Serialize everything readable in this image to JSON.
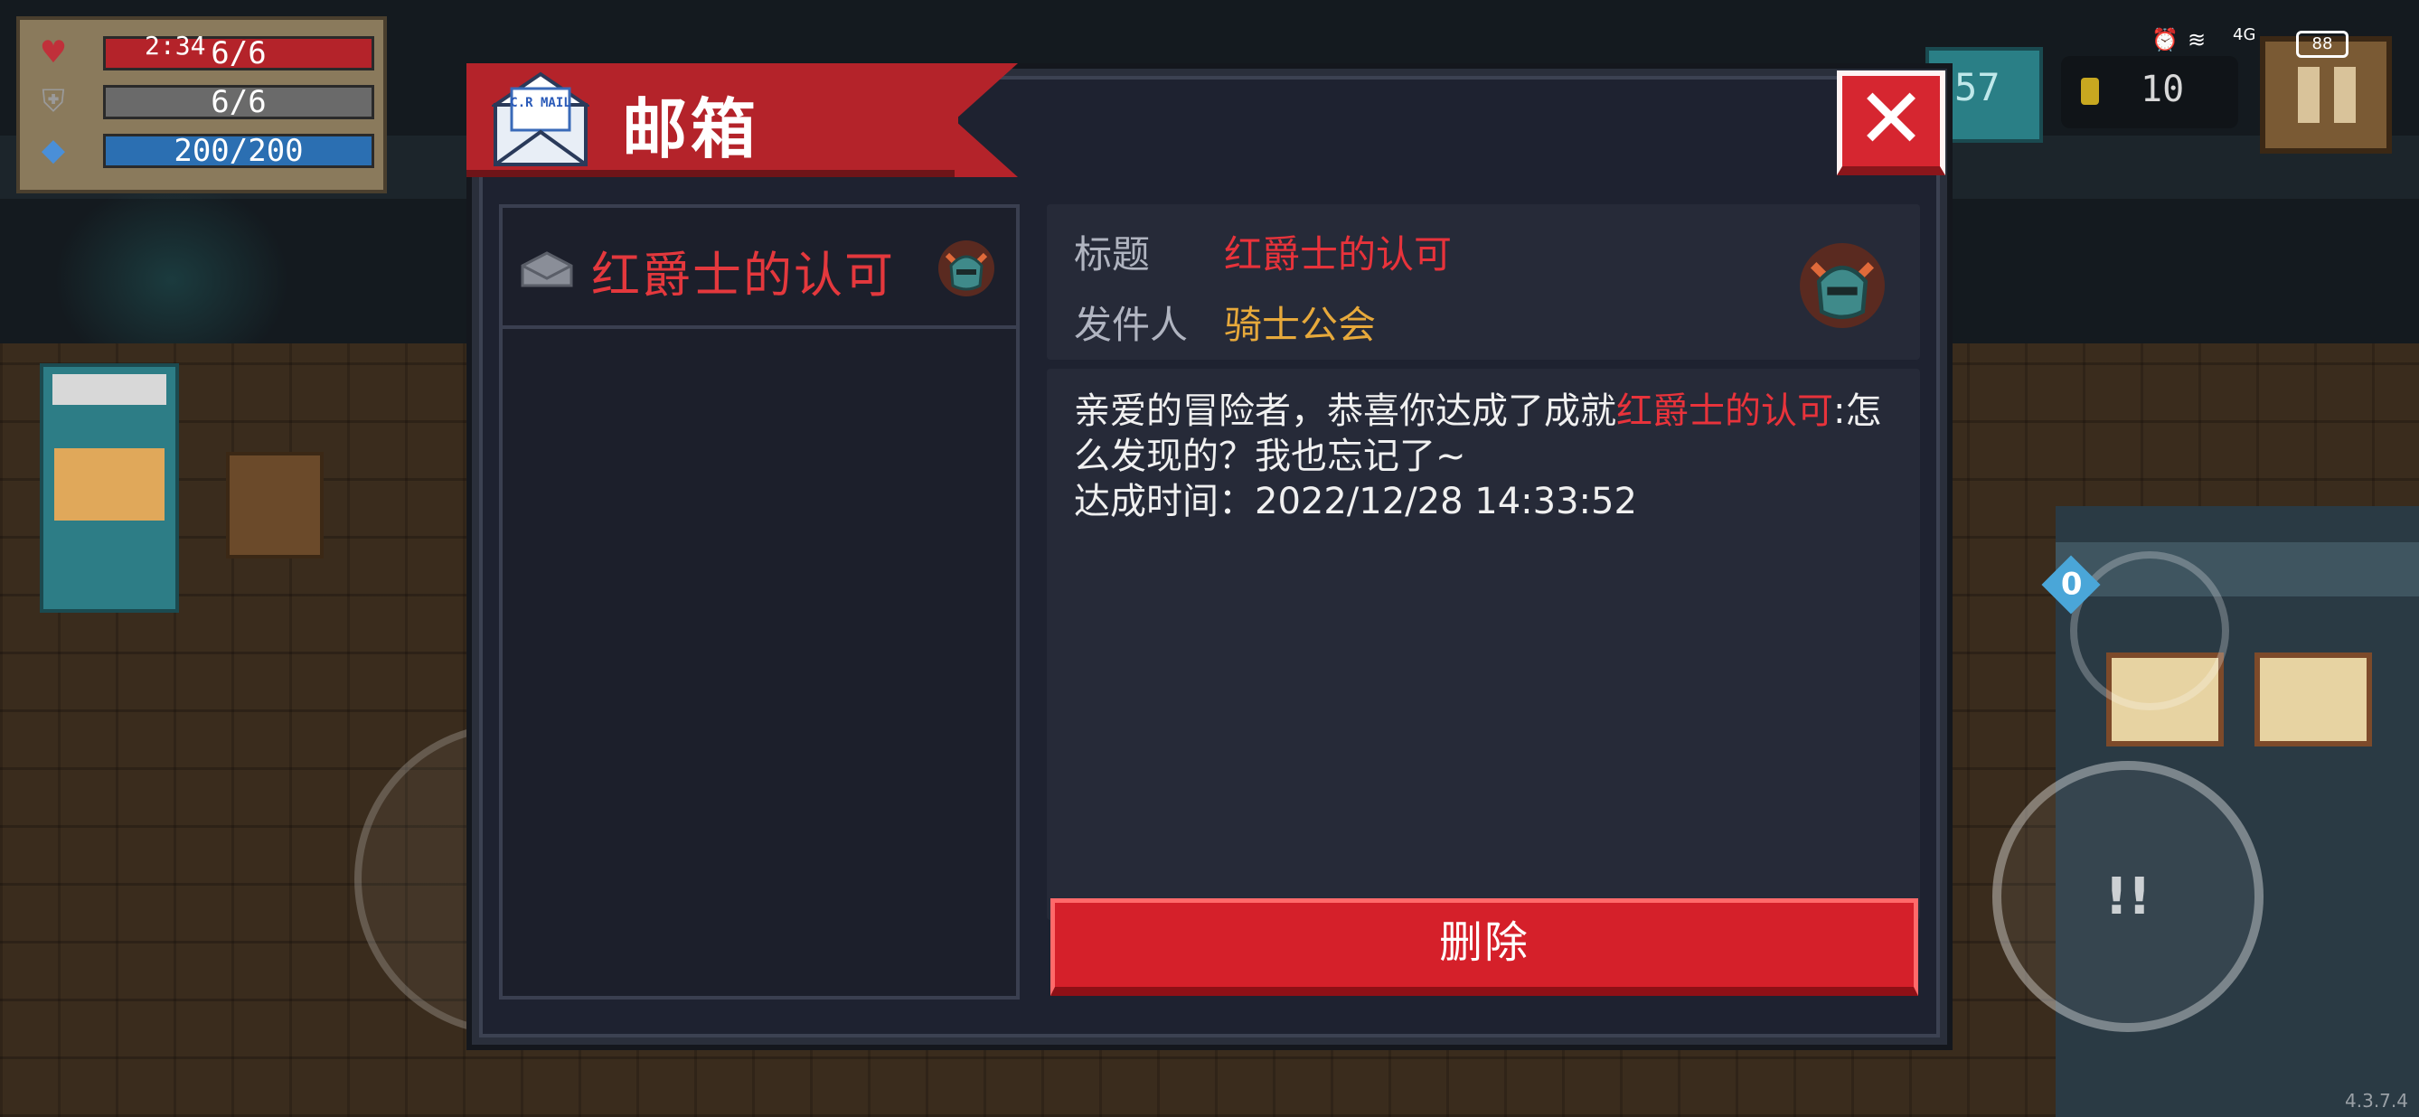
{
  "hud": {
    "clock": "2:34",
    "health": "6/6",
    "armor": "6/6",
    "energy": "200/200",
    "gems": "57",
    "coins": "10",
    "battery": "88",
    "signal_label": "4G",
    "health_icon": "heart-icon",
    "armor_icon": "shield-icon",
    "energy_icon": "diamond-icon",
    "colors": {
      "health": "#b4232a",
      "armor": "#6a6a6a",
      "energy": "#2b6fb2"
    }
  },
  "dialog": {
    "title": "邮箱",
    "close_label": "✕",
    "mail_icon": "mail-envelope-icon",
    "mail_icon_text": "C.R MAIL",
    "list": [
      {
        "title": "红爵士的认可",
        "icon": "helmet-icon"
      }
    ],
    "detail": {
      "title_label": "标题",
      "title_value": "红爵士的认可",
      "sender_label": "发件人",
      "sender_value": "骑士公会",
      "body_prefix": "亲爱的冒险者，恭喜你达成了成就",
      "body_highlight": "红爵士的认可",
      "body_suffix": ":怎么发现的？我也忘记了~",
      "body_time": "达成时间：2022/12/28 14:33:52"
    },
    "delete_label": "删除",
    "colors": {
      "accent_red": "#d5202a",
      "highlight_red": "#e8333b",
      "sender_gold": "#e7a93b",
      "panel": "#262a38"
    }
  },
  "controls": {
    "weapon_slot": "0",
    "version": "4.3.7.4"
  }
}
